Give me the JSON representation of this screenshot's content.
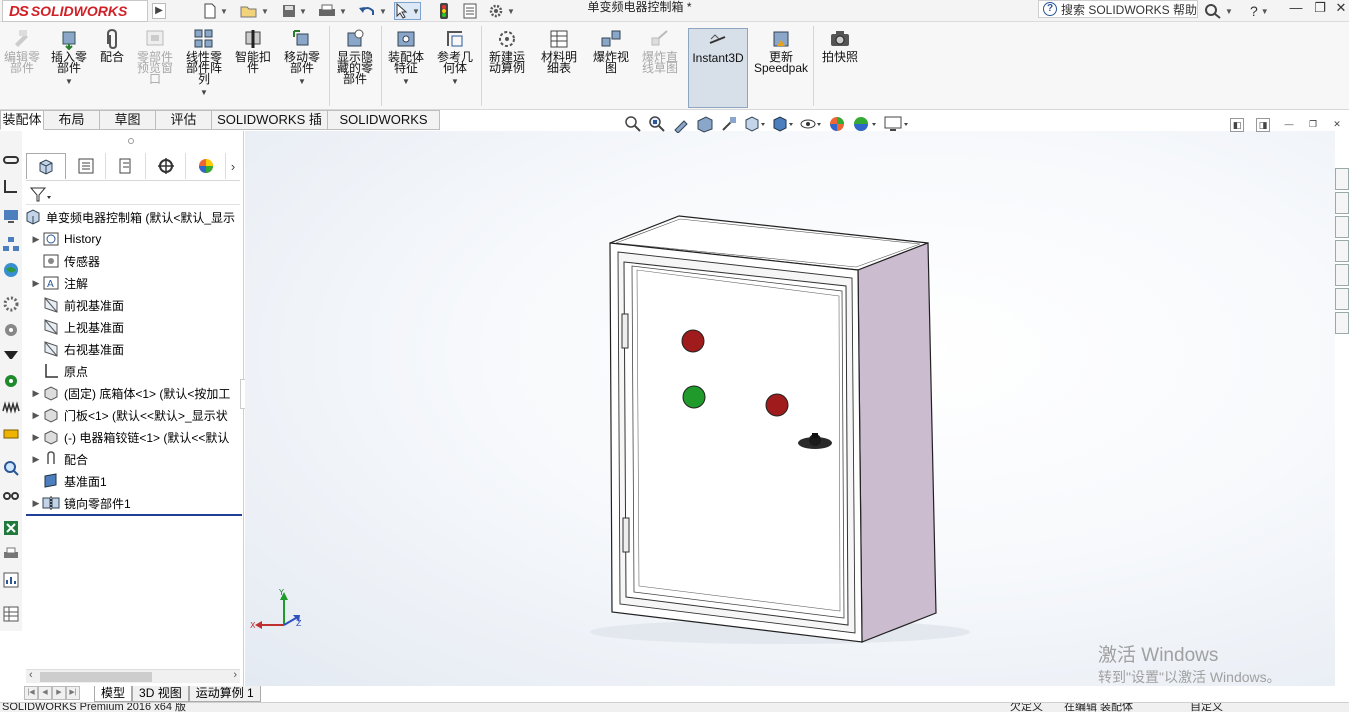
{
  "app": {
    "brand": "SOLIDWORKS",
    "document_title": "单变频电器控制箱 *",
    "search_placeholder": "搜索 SOLIDWORKS 帮助",
    "help_symbol": "?"
  },
  "window_controls": [
    "—",
    "❐",
    "✕"
  ],
  "ribbon": [
    {
      "label": "编辑零\n部件",
      "enabled": false
    },
    {
      "label": "插入零\n部件",
      "enabled": true,
      "dropdown": true
    },
    {
      "label": "配合",
      "enabled": true
    },
    {
      "label": "零部件\n预览窗\n口",
      "enabled": false
    },
    {
      "label": "线性零\n部件阵\n列",
      "enabled": true,
      "dropdown": true
    },
    {
      "label": "智能扣\n件",
      "enabled": true
    },
    {
      "label": "移动零\n部件",
      "enabled": true,
      "dropdown": true
    },
    {
      "label": "显示隐\n藏的零\n部件",
      "enabled": true
    },
    {
      "label": "装配体\n特征",
      "enabled": true,
      "dropdown": true
    },
    {
      "label": "参考几\n何体",
      "enabled": true,
      "dropdown": true
    },
    {
      "label": "新建运\n动算例",
      "enabled": true
    },
    {
      "label": "材料明\n细表",
      "enabled": true
    },
    {
      "label": "爆炸视\n图",
      "enabled": true
    },
    {
      "label": "爆炸直\n线草图",
      "enabled": false
    },
    {
      "label": "Instant3D",
      "enabled": true,
      "selected": true
    },
    {
      "label": "更新\nSpeedpak",
      "enabled": true
    },
    {
      "label": "拍快照",
      "enabled": true
    }
  ],
  "command_tabs": [
    "装配体",
    "布局",
    "草图",
    "评估",
    "SOLIDWORKS 插件",
    "SOLIDWORKS MBD"
  ],
  "feature_tree": {
    "root": "单变频电器控制箱  (默认<默认_显示",
    "items": [
      {
        "label": "History",
        "expandable": true
      },
      {
        "label": "传感器",
        "expandable": false
      },
      {
        "label": "注解",
        "expandable": true
      },
      {
        "label": "前视基准面",
        "expandable": false
      },
      {
        "label": "上视基准面",
        "expandable": false
      },
      {
        "label": "右视基准面",
        "expandable": false
      },
      {
        "label": "原点",
        "expandable": false
      },
      {
        "label": "(固定) 底箱体<1> (默认<按加工",
        "expandable": true
      },
      {
        "label": "门板<1> (默认<<默认>_显示状",
        "expandable": true
      },
      {
        "label": "(-) 电器箱铰链<1> (默认<<默认",
        "expandable": true
      },
      {
        "label": "配合",
        "expandable": true
      },
      {
        "label": "基准面1",
        "expandable": false
      },
      {
        "label": "镜向零部件1",
        "expandable": true
      }
    ]
  },
  "bottom_tabs": [
    "模型",
    "3D 视图",
    "运动算例 1"
  ],
  "status_bar": {
    "left": "SOLIDWORKS Premium 2016 x64 版",
    "state1": "欠定义",
    "state2": "在编辑 装配体",
    "units": "自定义"
  },
  "triad": {
    "x": "X",
    "y": "Y",
    "z": "Z"
  },
  "watermark": {
    "line1": "激活 Windows",
    "line2": "转到\"设置\"以激活 Windows。"
  },
  "colors": {
    "button_red": "#a01c1c",
    "button_green": "#1f9a2b",
    "cabinet_side": "#cbbccf",
    "brand_red": "#d21f26"
  }
}
